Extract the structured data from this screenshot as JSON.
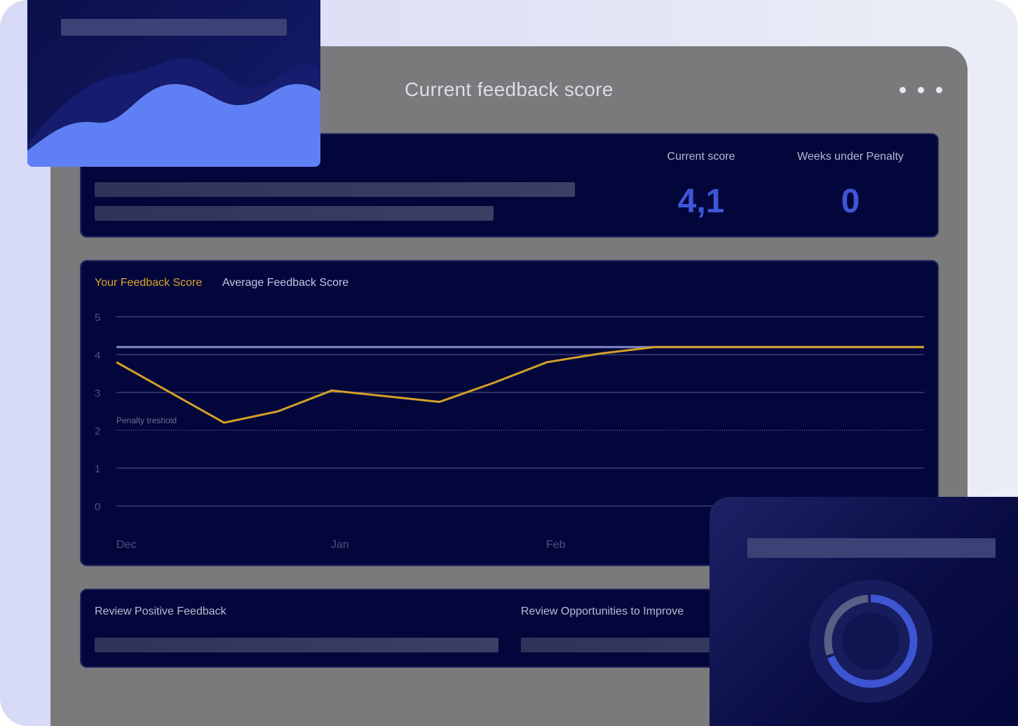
{
  "window": {
    "title": "Current feedback score"
  },
  "stats": {
    "current_score_label": "Current score",
    "current_score_value": "4,1",
    "weeks_penalty_label": "Weeks under Penalty",
    "weeks_penalty_value": "0"
  },
  "chart_data": {
    "type": "line",
    "legend": [
      "Your Feedback Score",
      "Average Feedback Score"
    ],
    "x_labels": [
      "Dec",
      "Jan",
      "Feb"
    ],
    "y_ticks": [
      5,
      4,
      3,
      2,
      1,
      0
    ],
    "ylim": [
      0,
      5
    ],
    "penalty_threshold": {
      "label": "Penalty treshold",
      "value": 2
    },
    "series": [
      {
        "name": "Your Feedback Score",
        "color": "#d4a128",
        "values": [
          3.8,
          3.0,
          2.2,
          2.5,
          3.05,
          2.9,
          2.75,
          3.25,
          3.8,
          4.03,
          4.2,
          4.2,
          4.2,
          4.2,
          4.2,
          4.2
        ]
      },
      {
        "name": "Average Feedback Score",
        "color": "#8187c8",
        "values": [
          4.2,
          4.2,
          4.2,
          4.2,
          4.2,
          4.2,
          4.2,
          4.2,
          4.2,
          4.2,
          4.2,
          4.2,
          4.2,
          4.2,
          4.2,
          4.2
        ]
      }
    ],
    "grid": true
  },
  "review": {
    "positive_label": "Review Positive Feedback",
    "improve_label": "Review  Opportunities to Improve"
  },
  "donut": {
    "segments": [
      {
        "color": "#3d55d2",
        "fraction": 0.7
      },
      {
        "color": "#5a5f86",
        "fraction": 0.3
      }
    ]
  }
}
